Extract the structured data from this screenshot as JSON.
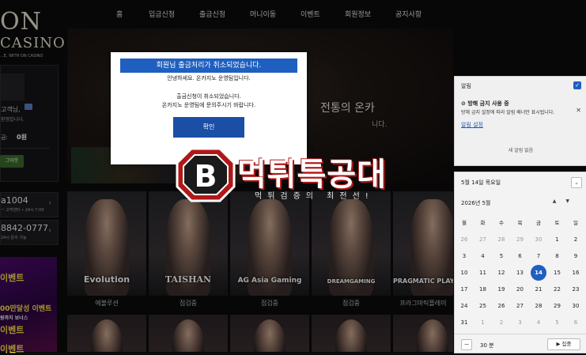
{
  "nav": {
    "items": [
      "홈",
      "입금신청",
      "출금신청",
      "머니이동",
      "이벤트",
      "회원정보",
      "공지사항"
    ]
  },
  "logo": {
    "big": "ON",
    "sub": "CASINO",
    "tagline": "...E, WITH ON CASINO"
  },
  "sidebar": {
    "greeting": "고객님,",
    "welcome": "환영합니다.",
    "balance_label": "금:",
    "balance_value": "0원",
    "logout_button": "그아웃",
    "contact1_big": "a1004",
    "contact1_small": "ㅡ 고객센터 • 24시 7:00",
    "contact2_big": "8842-0777",
    "contact2_small": "24시 문의 가능",
    "event_lines": [
      "이벤트",
      "00만달성 이벤트",
      "원까지 보너스",
      "이벤트",
      "이벤트"
    ]
  },
  "hero": {
    "line1": "전통의 온카",
    "line2": "니다."
  },
  "games": [
    {
      "brand": "Evolution",
      "caption": "에볼루션"
    },
    {
      "brand": "TAISHAN",
      "caption": "점검중"
    },
    {
      "brand": "AG Asia Gaming",
      "caption": "점검중"
    },
    {
      "brand": "DREAMGAMING",
      "caption": "점검중"
    },
    {
      "brand": "PRAGMATIC PLAY",
      "caption": "프라그마틱플레이"
    }
  ],
  "modal": {
    "title": "회원님 출금처리가 취소되었습니다.",
    "line1": "안녕하세요. 온카지노 운영팀입니다.",
    "line2": "출금신청이 취소되었습니다.",
    "line3": "온카지노 운영팀에 문의주시기 바랍니다.",
    "ok_button": "확인"
  },
  "watermark": {
    "title": "먹튀특공대",
    "subtitle": "먹튀검증의 최전선!"
  },
  "notifications": {
    "title": "알림",
    "item_title": "방해 금지 사용 중",
    "item_body": "방해 금지 설정에 따라 알림 배너만 표시됩니다.",
    "link": "알림 설정",
    "empty": "새 알림 없음"
  },
  "calendar": {
    "current_date": "5월 14일 목요일",
    "month_label": "2026년 5월",
    "weekdays": [
      "월",
      "화",
      "수",
      "목",
      "금",
      "토",
      "일"
    ],
    "weeks": [
      [
        26,
        27,
        28,
        29,
        30,
        1,
        2
      ],
      [
        3,
        4,
        5,
        6,
        7,
        8,
        9
      ],
      [
        10,
        11,
        12,
        13,
        14,
        15,
        16
      ],
      [
        17,
        18,
        19,
        20,
        21,
        22,
        23
      ],
      [
        24,
        25,
        26,
        27,
        28,
        29,
        30
      ],
      [
        31,
        1,
        2,
        3,
        4,
        5,
        6
      ]
    ],
    "today": 14,
    "focus_minutes": "30 분",
    "focus_button": "▶ 집중"
  },
  "colors": {
    "accent": "#1f5fbf",
    "watermark_red": "#b01818"
  }
}
